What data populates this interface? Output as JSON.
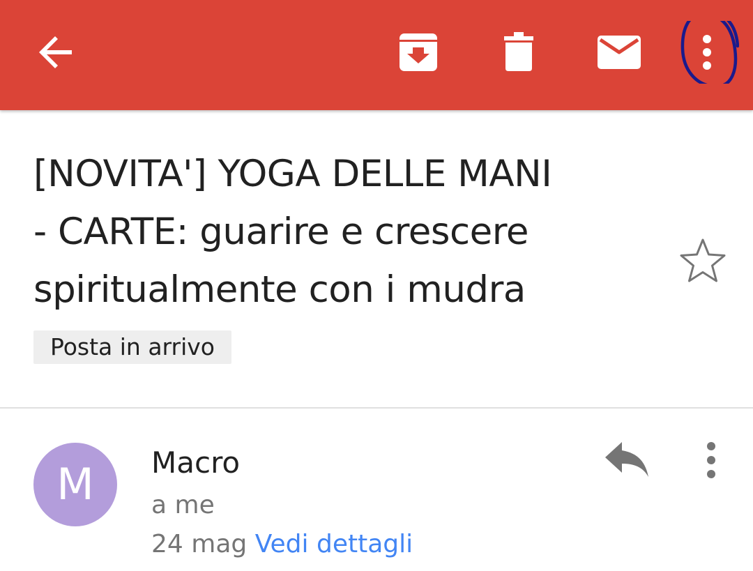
{
  "colors": {
    "accent": "#db4437",
    "avatar": "#b39ddb",
    "link": "#4285f4",
    "annotation_circle": "#1a1a8c"
  },
  "toolbar": {
    "icons": [
      "back-arrow-icon",
      "archive-icon",
      "delete-icon",
      "mark-unread-icon",
      "more-vert-icon"
    ]
  },
  "message": {
    "subject_lines": [
      "[NOVITA'] YOGA DELLE MANI",
      "- CARTE: guarire e crescere",
      "spiritualmente con i mudra"
    ],
    "label": "Posta in arrivo",
    "sender": {
      "initial": "M",
      "name": "Macro",
      "recipient": "a me",
      "date": "24 mag",
      "details_link": "Vedi dettagli"
    }
  }
}
